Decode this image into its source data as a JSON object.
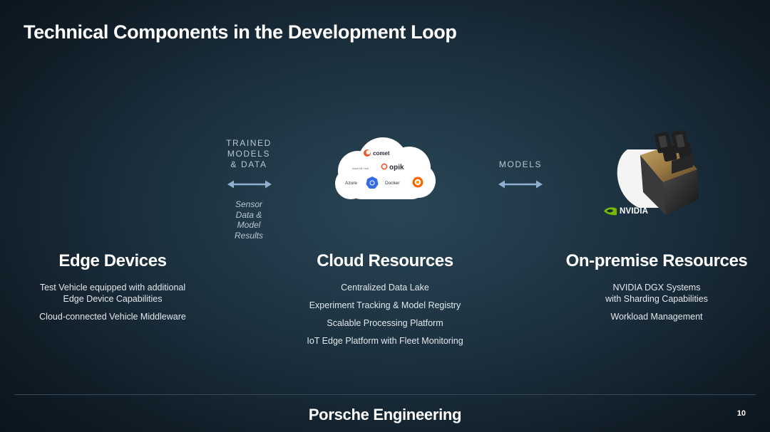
{
  "title": "Technical Components in the Development Loop",
  "left_connector": {
    "top_lines": [
      "TRAINED",
      "MODELS",
      "& DATA"
    ],
    "bottom_lines": [
      "Sensor",
      "Data &",
      "Model",
      "Results"
    ]
  },
  "right_connector": {
    "top_lines": [
      "MODELS"
    ]
  },
  "cloud_logos": {
    "comet": "comet",
    "opik": "opik",
    "opik_prefix": "Azure ML Hub",
    "azure": "Azure",
    "docker": "Docker",
    "kubernetes_icon": "kubernetes-icon",
    "grafana_icon": "grafana-icon"
  },
  "nvidia_logo": "NVIDIA",
  "columns": [
    {
      "heading": "Edge Devices",
      "items": [
        [
          "Test Vehicle equipped with additional",
          "Edge Device Capabilities"
        ],
        [
          "Cloud-connected Vehicle Middleware"
        ]
      ]
    },
    {
      "heading": "Cloud Resources",
      "items": [
        [
          "Centralized Data Lake"
        ],
        [
          "Experiment Tracking & Model Registry"
        ],
        [
          "Scalable Processing Platform"
        ],
        [
          "IoT Edge Platform with Fleet Monitoring"
        ]
      ]
    },
    {
      "heading": "On-premise Resources",
      "items": [
        [
          "NVIDIA DGX Systems",
          "with Sharding Capabilities"
        ],
        [
          "Workload Management"
        ]
      ]
    }
  ],
  "footer": {
    "brand": "Porsche Engineering",
    "page_number": "10"
  },
  "colors": {
    "arrow": "#8fb0cf",
    "label": "#b9c6cf",
    "nvidia_green": "#76b900"
  }
}
